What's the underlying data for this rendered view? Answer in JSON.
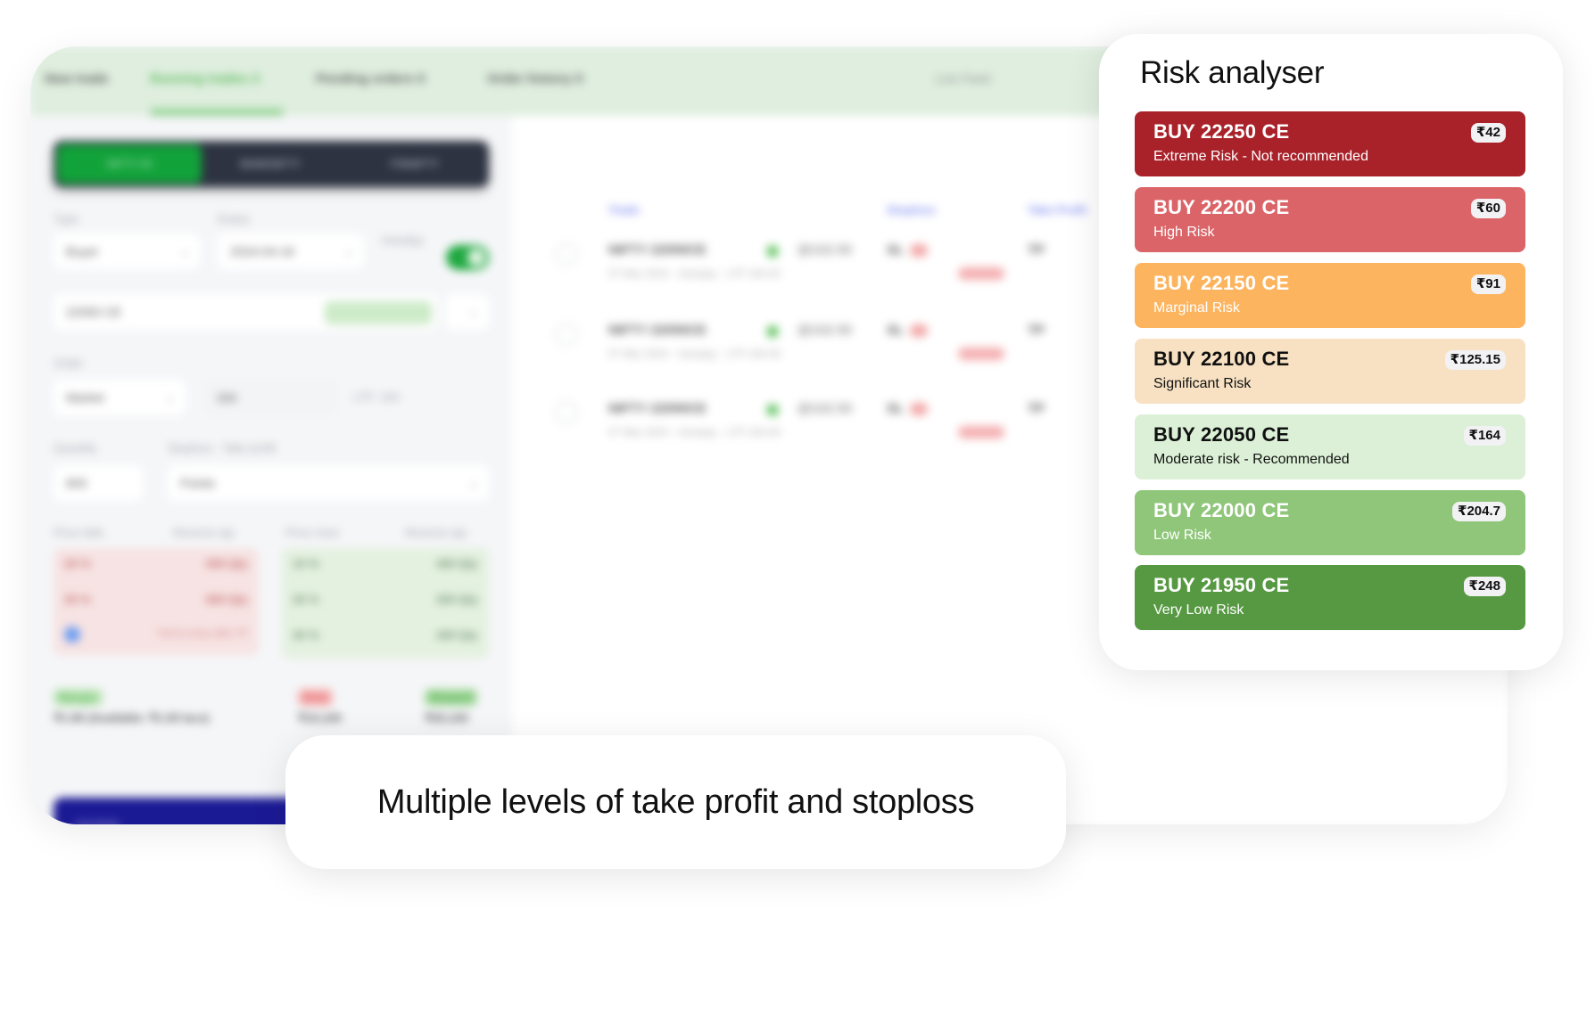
{
  "background_app": {
    "tabs": [
      {
        "label": "New trade",
        "active": false
      },
      {
        "label": "Running trades",
        "active": true,
        "count": "3"
      },
      {
        "label": "Pending orders",
        "active": false,
        "count": "0"
      },
      {
        "label": "Order history",
        "active": false,
        "count": "0"
      }
    ],
    "right_link": "Live Feed",
    "segments": [
      "NIFTY 50",
      "BANKNIFTY",
      "FINNIFTY"
    ],
    "form": {
      "type_label": "Type",
      "type_value": "Buyer",
      "expiry_label": "Expiry",
      "expiry_value": "2024-04-18",
      "intraday_label": "Intraday",
      "strike_value": "22050 CE",
      "strike_badge": "Moderate",
      "order_label": "Order",
      "order_value": "Market",
      "price_value": "164",
      "ltp_label": "LTP: 164",
      "quantity_label": "Quantity",
      "quantity_value": "600",
      "stoploss_label": "Stoploss - Take profit",
      "stoploss_value": "Points",
      "price_falls_label": "Price falls",
      "price_rises_label": "Price rises",
      "remove_qty_label": "Remove qty",
      "falls_rows": [
        {
          "pct": "20 %",
          "qty": "600 Qty"
        },
        {
          "pct": "30 %",
          "qty": "600 Qty"
        }
      ],
      "trail_label": "Trail to entry after TP",
      "rises_rows": [
        {
          "pct": "10 %",
          "qty": "400 Qty"
        },
        {
          "pct": "20 %",
          "qty": "200 Qty"
        },
        {
          "pct": "30 %",
          "qty": "200 Qty"
        }
      ],
      "margin_label": "Margin",
      "margin_value": "₹1.96 (Available: ₹1.00 lacs)",
      "risk_label": "Risk",
      "risk_value": "₹10,100",
      "reward_label": "Reward",
      "reward_value": "₹20,100",
      "submit_label": "ENTER"
    },
    "orders_columns": [
      "Trade",
      "Stoploss",
      "Take Profit"
    ],
    "orders": [
      {
        "name": "NIFTY 22050CE",
        "price": "@102.50",
        "sub": "07 Mar 2024 · Intraday · LTP 164.00",
        "sl": "SL",
        "loss": "-₹100.00",
        "tp": "TP"
      },
      {
        "name": "NIFTY 22050CE",
        "price": "@102.50",
        "sub": "07 Mar 2024 · Intraday · LTP 164.00",
        "sl": "SL",
        "loss": "-₹100.00",
        "tp": "TP"
      },
      {
        "name": "NIFTY 22050CE",
        "price": "@102.50",
        "sub": "07 Mar 2024 · Intraday · LTP 164.00",
        "sl": "SL",
        "loss": "-₹100.00",
        "tp": "TP"
      }
    ]
  },
  "risk_analyser": {
    "title": "Risk analyser",
    "rows": [
      {
        "strike": "BUY 22250 CE",
        "level": "Extreme Risk - Not recommended",
        "price": "₹42",
        "bg": "#a9222a",
        "fg": "#ffffff"
      },
      {
        "strike": "BUY 22200 CE",
        "level": "High Risk",
        "price": "₹60",
        "bg": "#db6468",
        "fg": "#ffffff"
      },
      {
        "strike": "BUY 22150 CE",
        "level": "Marginal Risk",
        "price": "₹91",
        "bg": "#fdb45f",
        "fg": "#ffffff"
      },
      {
        "strike": "BUY 22100 CE",
        "level": "Significant Risk",
        "price": "₹125.15",
        "bg": "#f7e1c2",
        "fg": "#111111"
      },
      {
        "strike": "BUY 22050 CE",
        "level": "Moderate risk - Recommended",
        "price": "₹164",
        "bg": "#dbf0d6",
        "fg": "#111111"
      },
      {
        "strike": "BUY 22000 CE",
        "level": "Low Risk",
        "price": "₹204.7",
        "bg": "#8fc67a",
        "fg": "#ffffff"
      },
      {
        "strike": "BUY 21950 CE",
        "level": "Very Low Risk",
        "price": "₹248",
        "bg": "#579942",
        "fg": "#ffffff"
      }
    ]
  },
  "caption": "Multiple levels of take profit and stoploss"
}
